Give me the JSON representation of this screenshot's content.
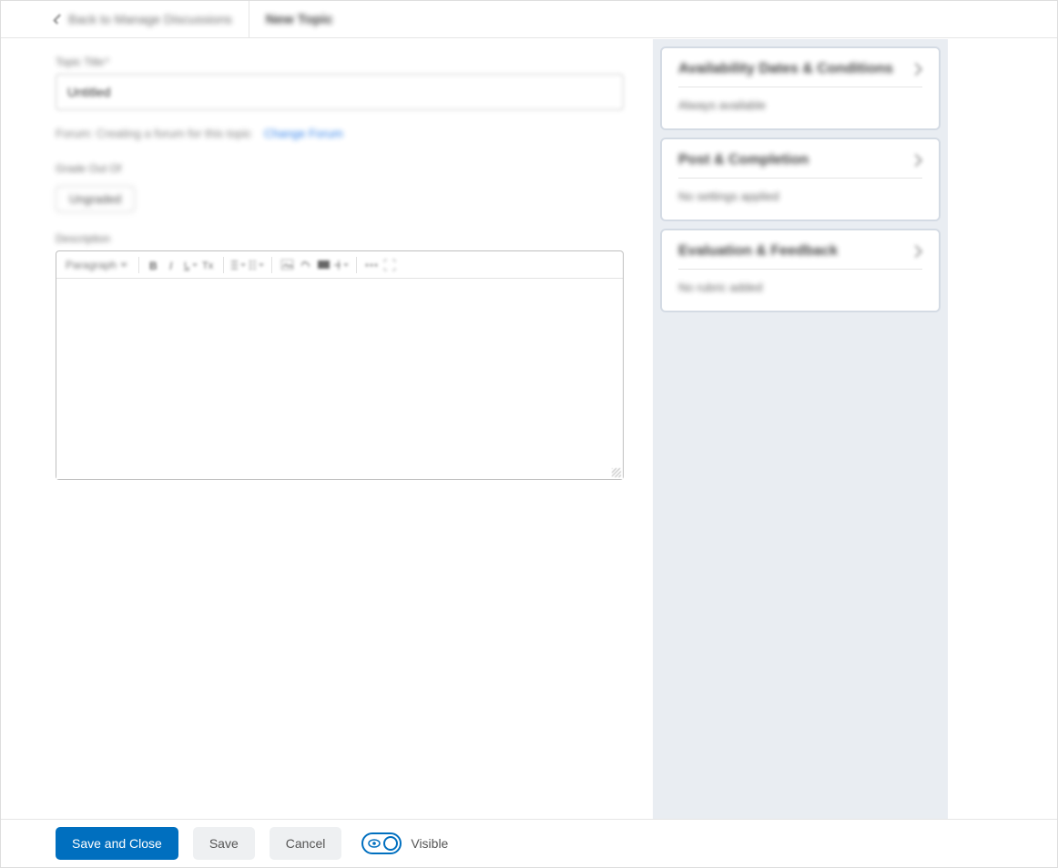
{
  "header": {
    "back_label": "Back to Manage Discussions",
    "page_title": "New Topic"
  },
  "form": {
    "title_label": "Topic Title",
    "title_value": "Untitled",
    "forum_static": "Forum: Creating a forum for this topic",
    "change_forum_label": "Change Forum",
    "grade_label": "Grade Out Of",
    "grade_chip": "Ungraded",
    "description_label": "Description",
    "editor_paragraph_label": "Paragraph"
  },
  "side": {
    "availability": {
      "title": "Availability Dates & Conditions",
      "summary": "Always available"
    },
    "post": {
      "title": "Post & Completion",
      "summary": "No settings applied"
    },
    "evaluation": {
      "title": "Evaluation & Feedback",
      "summary": "No rubric added"
    }
  },
  "footer": {
    "save_and_close": "Save and Close",
    "save": "Save",
    "cancel": "Cancel",
    "visibility_label": "Visible"
  }
}
